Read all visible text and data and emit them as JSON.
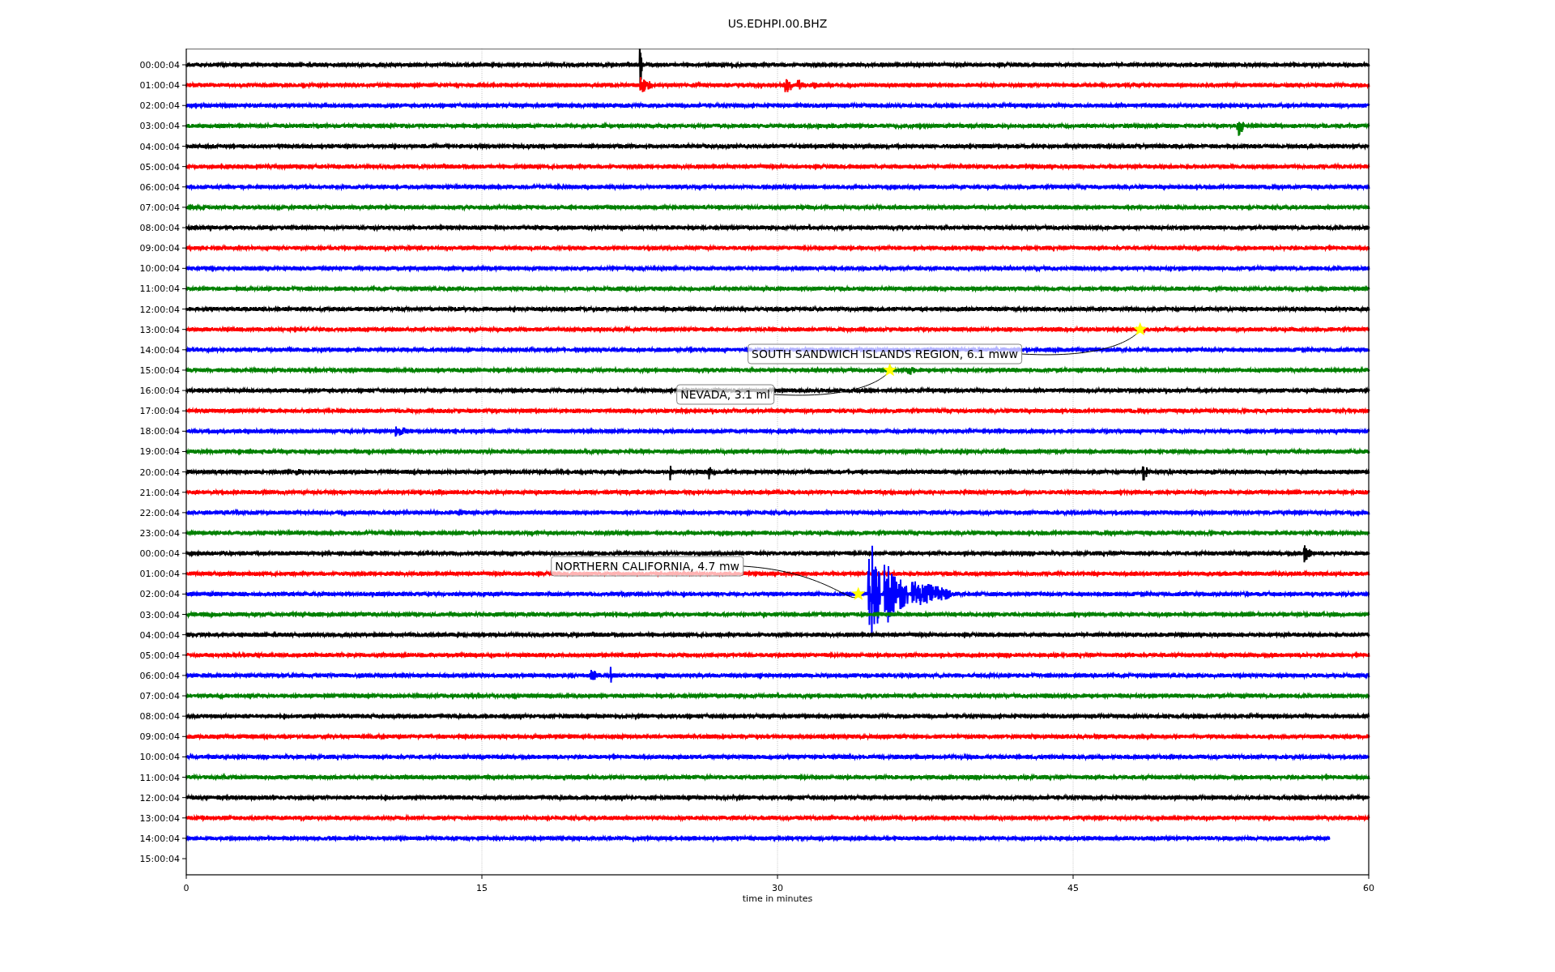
{
  "title": "US.EDHPI.00.BHZ",
  "rows": [
    {
      "label": "00:00:04",
      "color": "#000000",
      "kind": "full"
    },
    {
      "label": "01:00:04",
      "color": "#ff0000",
      "kind": "full"
    },
    {
      "label": "02:00:04",
      "color": "#0000ff",
      "kind": "full"
    },
    {
      "label": "03:00:04",
      "color": "#008000",
      "kind": "full"
    },
    {
      "label": "04:00:04",
      "color": "#000000",
      "kind": "full"
    },
    {
      "label": "05:00:04",
      "color": "#ff0000",
      "kind": "full"
    },
    {
      "label": "06:00:04",
      "color": "#0000ff",
      "kind": "full"
    },
    {
      "label": "07:00:04",
      "color": "#008000",
      "kind": "full"
    },
    {
      "label": "08:00:04",
      "color": "#000000",
      "kind": "full"
    },
    {
      "label": "09:00:04",
      "color": "#ff0000",
      "kind": "full"
    },
    {
      "label": "10:00:04",
      "color": "#0000ff",
      "kind": "full"
    },
    {
      "label": "11:00:04",
      "color": "#008000",
      "kind": "full"
    },
    {
      "label": "12:00:04",
      "color": "#000000",
      "kind": "full"
    },
    {
      "label": "13:00:04",
      "color": "#ff0000",
      "kind": "full"
    },
    {
      "label": "14:00:04",
      "color": "#0000ff",
      "kind": "full"
    },
    {
      "label": "15:00:04",
      "color": "#008000",
      "kind": "full"
    },
    {
      "label": "16:00:04",
      "color": "#000000",
      "kind": "full"
    },
    {
      "label": "17:00:04",
      "color": "#ff0000",
      "kind": "full"
    },
    {
      "label": "18:00:04",
      "color": "#0000ff",
      "kind": "full"
    },
    {
      "label": "19:00:04",
      "color": "#008000",
      "kind": "full"
    },
    {
      "label": "20:00:04",
      "color": "#000000",
      "kind": "full"
    },
    {
      "label": "21:00:04",
      "color": "#ff0000",
      "kind": "full"
    },
    {
      "label": "22:00:04",
      "color": "#0000ff",
      "kind": "full"
    },
    {
      "label": "23:00:04",
      "color": "#008000",
      "kind": "full"
    },
    {
      "label": "00:00:04",
      "color": "#000000",
      "kind": "full"
    },
    {
      "label": "01:00:04",
      "color": "#ff0000",
      "kind": "full"
    },
    {
      "label": "02:00:04",
      "color": "#0000ff",
      "kind": "full"
    },
    {
      "label": "03:00:04",
      "color": "#008000",
      "kind": "full"
    },
    {
      "label": "04:00:04",
      "color": "#000000",
      "kind": "full"
    },
    {
      "label": "05:00:04",
      "color": "#ff0000",
      "kind": "full"
    },
    {
      "label": "06:00:04",
      "color": "#0000ff",
      "kind": "full"
    },
    {
      "label": "07:00:04",
      "color": "#008000",
      "kind": "full"
    },
    {
      "label": "08:00:04",
      "color": "#000000",
      "kind": "full"
    },
    {
      "label": "09:00:04",
      "color": "#ff0000",
      "kind": "full"
    },
    {
      "label": "10:00:04",
      "color": "#0000ff",
      "kind": "full"
    },
    {
      "label": "11:00:04",
      "color": "#008000",
      "kind": "full"
    },
    {
      "label": "12:00:04",
      "color": "#000000",
      "kind": "full"
    },
    {
      "label": "13:00:04",
      "color": "#ff0000",
      "kind": "full"
    },
    {
      "label": "14:00:04",
      "color": "#0000ff",
      "kind": "partial"
    },
    {
      "label": "15:00:04",
      "kind": "none"
    }
  ],
  "events": [
    {
      "text": "SOUTH SANDWICH ISLANDS REGION, 6.1 mww"
    },
    {
      "text": "NEVADA, 3.1 ml"
    },
    {
      "text": "NORTHERN CALIFORNIA, 4.7 mw"
    }
  ],
  "x_ticks": [
    "0",
    "15",
    "30",
    "45",
    "60"
  ],
  "x_label": "time in minutes"
}
